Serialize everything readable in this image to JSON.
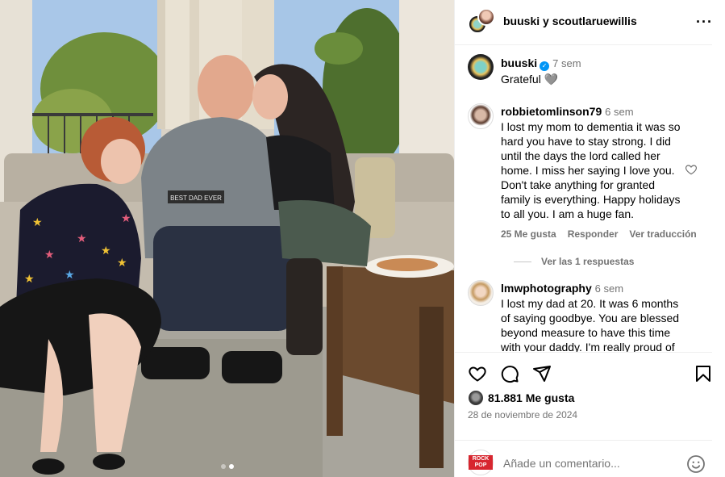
{
  "header": {
    "user1": "buuski",
    "conjunction": "y",
    "user2": "scoutlaruewillis",
    "more_icon": "more-horizontal-icon"
  },
  "caption": {
    "username": "buuski",
    "verified": true,
    "time": "7 sem",
    "text": "Grateful 🩶"
  },
  "comments": [
    {
      "username": "robbietomlinson79",
      "time": "6 sem",
      "text": "I lost my mom to dementia it was so hard you have to stay strong. I did until the days the lord called her home. I miss her saying I love you. Don't take anything for granted family is everything. Happy holidays to all you. I am a huge fan.",
      "likes": "25 Me gusta",
      "reply_label": "Responder",
      "translate_label": "Ver traducción",
      "view_replies": "Ver las 1 respuestas"
    },
    {
      "username": "lmwphotography",
      "time": "6 sem",
      "text": "I lost my dad at 20. It was 6 months of saying goodbye. You are blessed beyond measure to have this time with your daddy. I'm really proud of"
    }
  ],
  "actions": {
    "like_icon": "heart-icon",
    "comment_icon": "comment-icon",
    "share_icon": "send-icon",
    "save_icon": "bookmark-icon",
    "likes_count": "81.881 Me gusta",
    "date": "28 de noviembre de 2024"
  },
  "add_comment": {
    "avatar_label": "ROCK POP",
    "placeholder": "Añade un comentario...",
    "emoji_icon": "emoji-icon"
  },
  "photo": {
    "sign_text": "BEST DAD EVER",
    "carousel": {
      "count": 2,
      "active": 2
    }
  },
  "colors": {
    "verified": "#0095f6",
    "secondary_text": "#737373",
    "divider": "#efefef"
  }
}
